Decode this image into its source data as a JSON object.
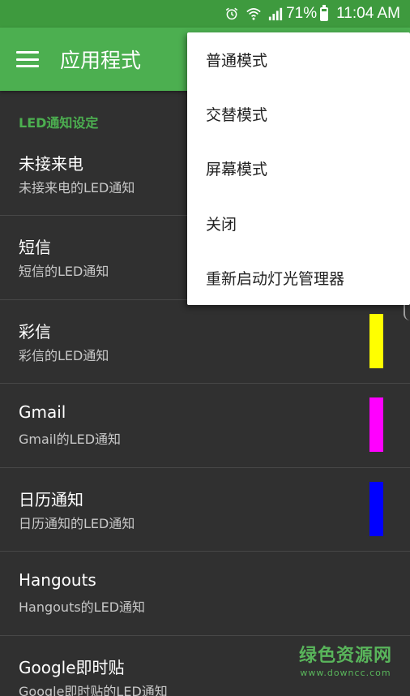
{
  "status_bar": {
    "battery_percent": "71%",
    "battery_level": 0.71,
    "time": "11:04 AM",
    "icons": [
      "alarm-icon",
      "wifi-icon",
      "signal-icon",
      "battery-icon"
    ]
  },
  "app_bar": {
    "title": "应用程式",
    "menu_icon": "hamburger-menu-icon"
  },
  "section": {
    "header": "LED通知设定"
  },
  "items": [
    {
      "title": "未接来电",
      "subtitle": "未接来电的LED通知",
      "color": ""
    },
    {
      "title": "短信",
      "subtitle": "短信的LED通知",
      "color": ""
    },
    {
      "title": "彩信",
      "subtitle": "彩信的LED通知",
      "color": "#ffff00"
    },
    {
      "title": "Gmail",
      "subtitle": "Gmail的LED通知",
      "color": "#ff00ff"
    },
    {
      "title": "日历通知",
      "subtitle": "日历通知的LED通知",
      "color": "#0000ff"
    },
    {
      "title": "Hangouts",
      "subtitle": "Hangouts的LED通知",
      "color": ""
    },
    {
      "title": "Google即时贴",
      "subtitle": "Google即时贴的LED通知",
      "color": ""
    }
  ],
  "menu": {
    "items": [
      "普通模式",
      "交替模式",
      "屏幕模式",
      "关闭",
      "重新启动灯光管理器"
    ]
  },
  "watermark": {
    "cn": "绿色资源网",
    "en": "www.downcc.com"
  },
  "colors": {
    "status_bar": "#3e9a3e",
    "app_bar": "#4caf50",
    "accent": "#4caf50",
    "background": "#303030"
  }
}
